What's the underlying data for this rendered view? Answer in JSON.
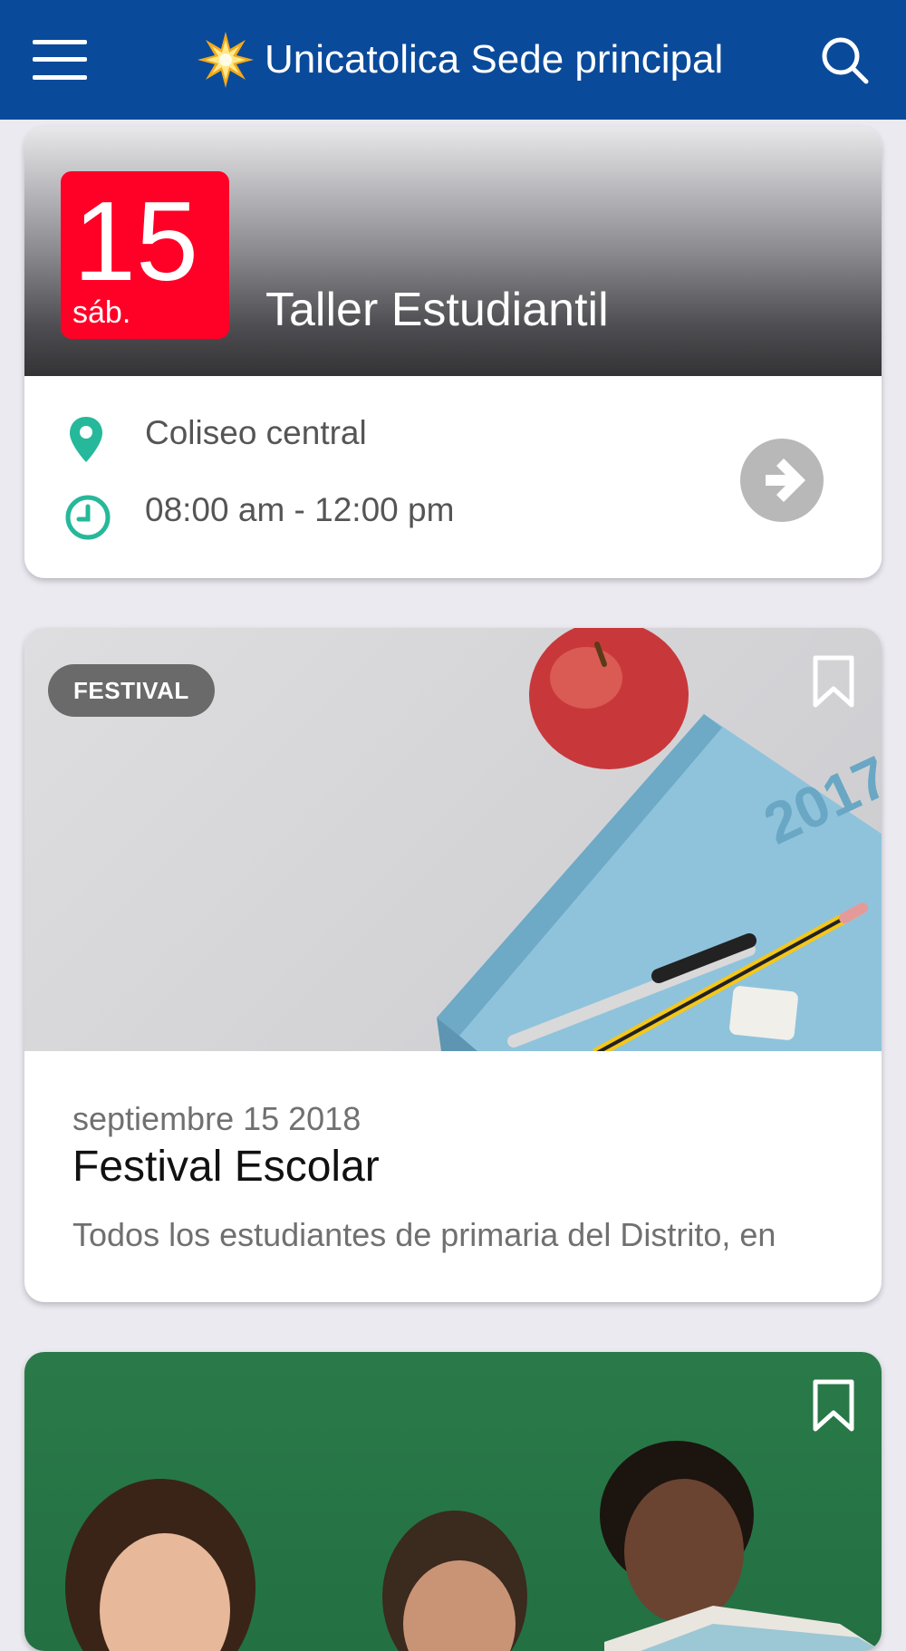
{
  "app": {
    "title": "Unicatolica Sede principal",
    "bar_color": "#0a4a9b",
    "icons": {
      "menu": "hamburger-menu-icon",
      "logo": "star-burst-logo",
      "search": "search-icon"
    }
  },
  "event_card": {
    "day": "15",
    "weekday": "sáb.",
    "title": "Taller Estudiantil",
    "location": "Coliseo central",
    "time": "08:00 am - 12:00 pm",
    "badge_color": "#ff0026",
    "icon_color": "#26b89a",
    "icons": {
      "location": "map-pin-icon",
      "time": "clock-icon",
      "go": "arrow-right-circle-icon"
    }
  },
  "festival_card": {
    "category": "FESTIVAL",
    "date": "septiembre 15 2018",
    "title": "Festival Escolar",
    "description": "Todos los estudiantes de primaria del Distrito, en",
    "icons": {
      "bookmark": "bookmark-icon"
    }
  },
  "kids_card": {
    "icons": {
      "bookmark": "bookmark-icon"
    }
  }
}
